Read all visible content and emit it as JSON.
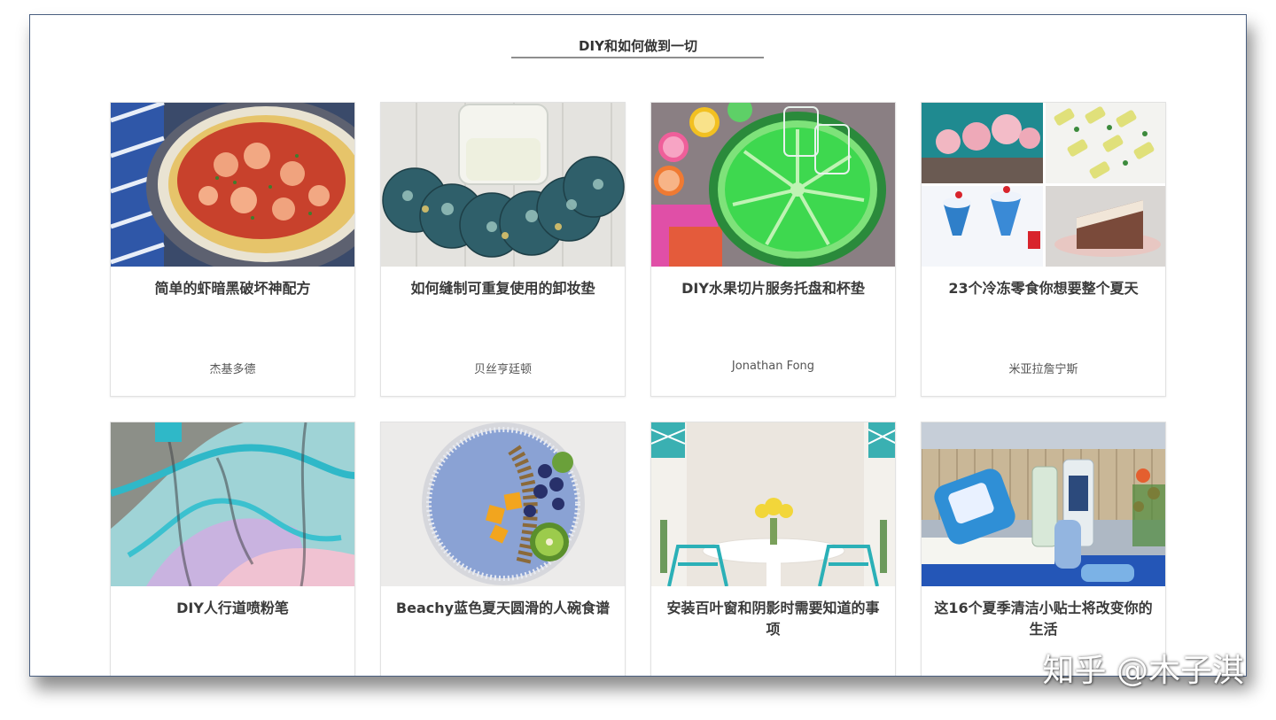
{
  "section": {
    "title": "DIY和如何做到一切"
  },
  "cards": [
    {
      "title": "简单的虾暗黑破坏神配方",
      "author": "杰基多德",
      "image": "shrimp-pasta-image"
    },
    {
      "title": "如何缝制可重复使用的卸妆垫",
      "author": "贝丝亨廷顿",
      "image": "makeup-pads-image"
    },
    {
      "title": "DIY水果切片服务托盘和杯垫",
      "author": "Jonathan Fong",
      "image": "lime-tray-image"
    },
    {
      "title": "23个冷冻零食你想要整个夏天",
      "author": "米亚拉詹宁斯",
      "image": "frozen-treats-image"
    },
    {
      "title": "DIY人行道喷粉笔",
      "author": "",
      "image": "sidewalk-chalk-image"
    },
    {
      "title": "Beachy蓝色夏天圆滑的人碗食谱",
      "author": "",
      "image": "smoothie-bowl-image"
    },
    {
      "title": "安装百叶窗和阴影时需要知道的事项",
      "author": "",
      "image": "dining-room-image"
    },
    {
      "title": "这16个夏季清洁小贴士将改变你的生活",
      "author": "",
      "image": "cleaning-supplies-image"
    }
  ],
  "watermark": "知乎 @木子淇"
}
